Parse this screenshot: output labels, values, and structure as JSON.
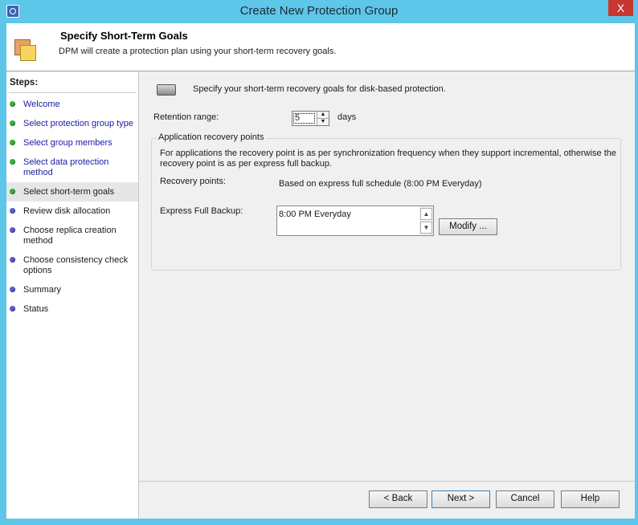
{
  "window": {
    "title": "Create New Protection Group",
    "close_glyph": "X"
  },
  "header": {
    "title": "Specify Short-Term Goals",
    "subtitle": "DPM will create a protection plan using your short-term recovery goals."
  },
  "steps": {
    "title": "Steps:",
    "items": [
      {
        "label": "Welcome",
        "state": "done"
      },
      {
        "label": "Select protection group type",
        "state": "done"
      },
      {
        "label": "Select group members",
        "state": "done"
      },
      {
        "label": "Select data protection method",
        "state": "done"
      },
      {
        "label": "Select short-term goals",
        "state": "current"
      },
      {
        "label": "Review disk allocation",
        "state": "pending"
      },
      {
        "label": "Choose replica creation method",
        "state": "pending"
      },
      {
        "label": "Choose consistency check options",
        "state": "pending"
      },
      {
        "label": "Summary",
        "state": "pending"
      },
      {
        "label": "Status",
        "state": "pending"
      }
    ]
  },
  "main": {
    "intro": "Specify your short-term recovery goals for disk-based protection.",
    "retention": {
      "label": "Retention range:",
      "value": "5",
      "unit": "days"
    },
    "app_recovery": {
      "group_title": "Application recovery points",
      "description": "For applications the recovery point is as per synchronization frequency when they support incremental, otherwise the recovery point is as per express full backup.",
      "recovery_points_label": "Recovery points:",
      "recovery_points_value": "Based on express full schedule (8:00 PM Everyday)",
      "express_full_label": "Express Full Backup:",
      "express_full_items": [
        "8:00 PM Everyday"
      ],
      "modify_label": "Modify ..."
    }
  },
  "buttons": {
    "back": "< Back",
    "next": "Next >",
    "cancel": "Cancel",
    "help": "Help"
  },
  "icons": {
    "app": "protection-group-icon",
    "header": "folders-icon",
    "intro": "disk-icon",
    "status_done": "green-dot-icon",
    "status_pending": "blue-dot-icon"
  },
  "colors": {
    "title_bar": "#5ec6e8",
    "close_button": "#c7372f",
    "link": "#1a1aa6",
    "done_dot": "#36b03a",
    "pending_dot": "#5a5ecc"
  }
}
